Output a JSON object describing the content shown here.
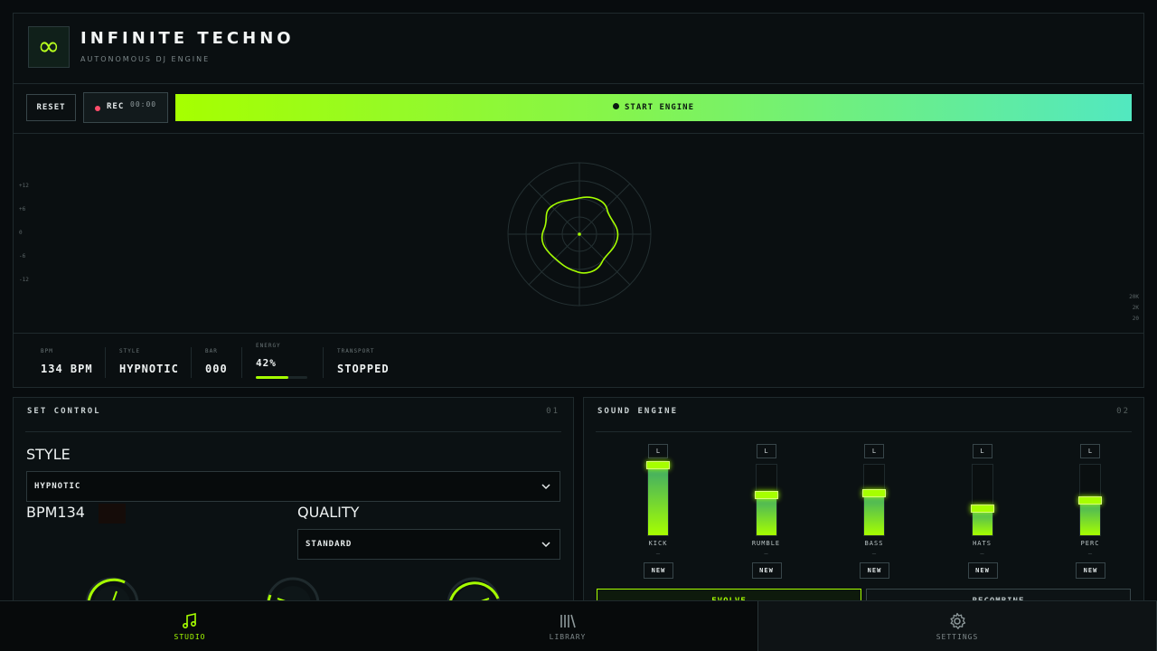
{
  "header": {
    "logo_glyph": "∞",
    "title": "INFINITE TECHNO",
    "subtitle": "AUTONOMOUS DJ ENGINE"
  },
  "toolbar": {
    "reset_label": "RESET",
    "rec_label": "REC",
    "rec_time": "00:00",
    "start_label": "START ENGINE"
  },
  "visualizer": {
    "db_labels": [
      "+12",
      "+6",
      "0",
      "-6",
      "-12"
    ],
    "freq_labels": [
      "20K",
      "2K",
      "20"
    ]
  },
  "stats": {
    "bpm_label": "BPM",
    "bpm_value": "134 BPM",
    "style_label": "STYLE",
    "style_value": "HYPNOTIC",
    "bar_label": "BAR",
    "bar_value": "000",
    "energy_label": "ENERGY",
    "energy_value": "42%",
    "energy_fraction": 0.63,
    "transport_label": "TRANSPORT",
    "transport_value": "STOPPED"
  },
  "set_control": {
    "title": "SET CONTROL",
    "number": "01",
    "style_label": "STYLE",
    "style_value": "HYPNOTIC",
    "bpm_label": "BPM134",
    "quality_label": "QUALITY",
    "quality_value": "STANDARD"
  },
  "sound_engine": {
    "title": "SOUND ENGINE",
    "number": "02",
    "channels": [
      {
        "name": "KICK",
        "mode": "L",
        "level": 1.0,
        "dash": "—",
        "new_label": "NEW"
      },
      {
        "name": "RUMBLE",
        "mode": "L",
        "level": 0.58,
        "dash": "—",
        "new_label": "NEW"
      },
      {
        "name": "BASS",
        "mode": "L",
        "level": 0.6,
        "dash": "—",
        "new_label": "NEW"
      },
      {
        "name": "HATS",
        "mode": "L",
        "level": 0.38,
        "dash": "—",
        "new_label": "NEW"
      },
      {
        "name": "PERC",
        "mode": "L",
        "level": 0.5,
        "dash": "—",
        "new_label": "NEW"
      }
    ],
    "evolve_label": "EVOLVE",
    "recombine_label": "RECOMBINE"
  },
  "nav": {
    "studio": "STUDIO",
    "library": "LIBRARY",
    "settings": "SETTINGS"
  },
  "colors": {
    "accent": "#a6ff00",
    "accent_teal": "#52e8c0",
    "record": "#ff4d6a",
    "background": "#080c0e"
  }
}
